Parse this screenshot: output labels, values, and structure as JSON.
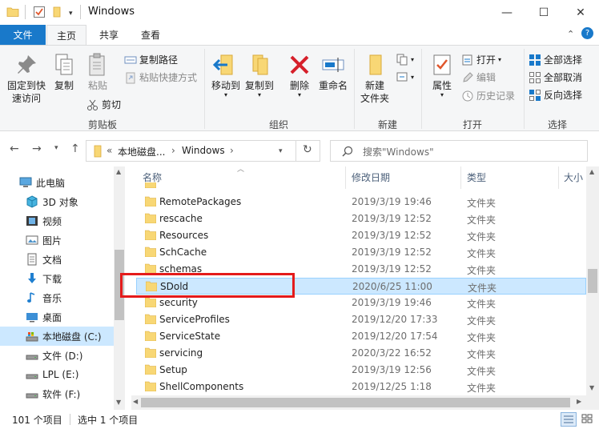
{
  "window": {
    "title": "Windows",
    "minimize": "—",
    "maximize": "☐",
    "close": "✕"
  },
  "tabs": {
    "file": "文件",
    "home": "主页",
    "share": "共享",
    "view": "查看"
  },
  "ribbon": {
    "clipboard": {
      "label": "剪贴板",
      "pin_line1": "固定到快",
      "pin_line2": "速访问",
      "copy": "复制",
      "paste": "粘贴",
      "copy_path": "复制路径",
      "paste_shortcut": "粘贴快捷方式",
      "cut": "剪切"
    },
    "organize": {
      "label": "组织",
      "move_to": "移动到",
      "copy_to": "复制到",
      "delete": "删除",
      "rename": "重命名"
    },
    "new": {
      "label": "新建",
      "new_folder_line1": "新建",
      "new_folder_line2": "文件夹"
    },
    "open": {
      "label": "打开",
      "properties": "属性",
      "open": "打开",
      "edit": "编辑",
      "history": "历史记录"
    },
    "select": {
      "label": "选择",
      "select_all": "全部选择",
      "select_none": "全部取消",
      "invert": "反向选择"
    }
  },
  "address": {
    "prefix": "«",
    "segment1": "本地磁盘...",
    "separator1": "›",
    "segment2": "Windows",
    "separator2": "›"
  },
  "search": {
    "placeholder": "搜索\"Windows\""
  },
  "nav_pane": {
    "items": [
      {
        "label": "此电脑"
      },
      {
        "label": "3D 对象"
      },
      {
        "label": "视频"
      },
      {
        "label": "图片"
      },
      {
        "label": "文档"
      },
      {
        "label": "下载"
      },
      {
        "label": "音乐"
      },
      {
        "label": "桌面"
      },
      {
        "label": "本地磁盘 (C:)"
      },
      {
        "label": "文件 (D:)"
      },
      {
        "label": "LPL (E:)"
      },
      {
        "label": "软件 (F:)"
      }
    ]
  },
  "file_list": {
    "columns": {
      "name": "名称",
      "date": "修改日期",
      "type": "类型",
      "size": "大小"
    },
    "rows": [
      {
        "name": "RemotePackages",
        "date": "2019/3/19 19:46",
        "type": "文件夹"
      },
      {
        "name": "rescache",
        "date": "2019/3/19 12:52",
        "type": "文件夹"
      },
      {
        "name": "Resources",
        "date": "2019/3/19 12:52",
        "type": "文件夹"
      },
      {
        "name": "SchCache",
        "date": "2019/3/19 12:52",
        "type": "文件夹"
      },
      {
        "name": "schemas",
        "date": "2019/3/19 12:52",
        "type": "文件夹"
      },
      {
        "name": "SDold",
        "date": "2020/6/25 11:00",
        "type": "文件夹"
      },
      {
        "name": "security",
        "date": "2019/3/19 19:46",
        "type": "文件夹"
      },
      {
        "name": "ServiceProfiles",
        "date": "2019/12/20 17:33",
        "type": "文件夹"
      },
      {
        "name": "ServiceState",
        "date": "2019/12/20 17:54",
        "type": "文件夹"
      },
      {
        "name": "servicing",
        "date": "2020/3/22 16:52",
        "type": "文件夹"
      },
      {
        "name": "Setup",
        "date": "2019/3/19 12:56",
        "type": "文件夹"
      },
      {
        "name": "ShellComponents",
        "date": "2019/12/25 1:18",
        "type": "文件夹"
      }
    ]
  },
  "status": {
    "item_count": "101 个项目",
    "selected": "选中 1 个项目"
  },
  "colors": {
    "accent": "#1979ca",
    "selection": "#cce8ff",
    "highlight": "#e41b1b",
    "folder": "#f8d775"
  }
}
